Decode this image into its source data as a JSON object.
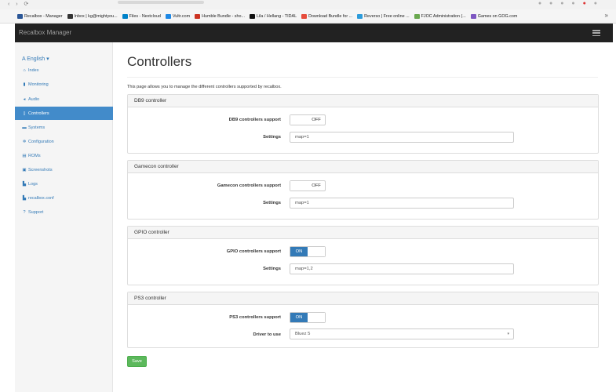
{
  "browser": {
    "bookmarks": [
      {
        "label": "Recalbox - Manager",
        "color": "#2b5797"
      },
      {
        "label": "Inbox | kg@mightyou...",
        "color": "#333333"
      },
      {
        "label": "Files - Nextcloud",
        "color": "#0082c9"
      },
      {
        "label": "Vultr.com",
        "color": "#1e88e5"
      },
      {
        "label": "Humble Bundle - sho...",
        "color": "#cc3322"
      },
      {
        "label": "Lila / Hellang - TIDAL",
        "color": "#111111"
      },
      {
        "label": "Download Bundle for ...",
        "color": "#e74c3c"
      },
      {
        "label": "Reverso | Free online ...",
        "color": "#2d9cdb"
      },
      {
        "label": "FJOC Administration (...",
        "color": "#6aa84f"
      },
      {
        "label": "Games on GOG.com",
        "color": "#7e57c2"
      }
    ],
    "more_label": "»"
  },
  "navbar": {
    "brand": "Recalbox Manager"
  },
  "sidebar": {
    "language": "A English ▾",
    "items": [
      {
        "label": "Index",
        "icon": "home-icon",
        "glyph": "⌂",
        "active": false
      },
      {
        "label": "Monitoring",
        "icon": "bar-chart-icon",
        "glyph": "▮",
        "active": false
      },
      {
        "label": "Audio",
        "icon": "volume-icon",
        "glyph": "◂",
        "active": false
      },
      {
        "label": "Controllers",
        "icon": "gamepad-icon",
        "glyph": "▯",
        "active": true
      },
      {
        "label": "Systems",
        "icon": "monitor-icon",
        "glyph": "▬",
        "active": false
      },
      {
        "label": "Configuration",
        "icon": "cog-icon",
        "glyph": "✲",
        "active": false
      },
      {
        "label": "ROMs",
        "icon": "film-icon",
        "glyph": "▤",
        "active": false
      },
      {
        "label": "Screenshots",
        "icon": "picture-icon",
        "glyph": "▣",
        "active": false
      },
      {
        "label": "Logs",
        "icon": "file-icon",
        "glyph": "▙",
        "active": false
      },
      {
        "label": "recalbox.conf",
        "icon": "file-icon",
        "glyph": "▙",
        "active": false
      },
      {
        "label": "Support",
        "icon": "question-icon",
        "glyph": "?",
        "active": false
      }
    ]
  },
  "main": {
    "title": "Controllers",
    "intro": "This page allows you to manage the different controllers supported by recalbox.",
    "panels": [
      {
        "heading": "DB9 controller",
        "support_label": "DB9 controllers support",
        "toggle": "OFF",
        "settings_label": "Settings",
        "settings_value": "map=1"
      },
      {
        "heading": "Gamecon controller",
        "support_label": "Gamecon controllers support",
        "toggle": "OFF",
        "settings_label": "Settings",
        "settings_value": "map=1"
      },
      {
        "heading": "GPIO controller",
        "support_label": "GPIO controllers support",
        "toggle": "ON",
        "settings_label": "Settings",
        "settings_value": "map=1,2"
      },
      {
        "heading": "PS3 controller",
        "support_label": "PS3 controllers support",
        "toggle": "ON",
        "settings_label": "Driver to use",
        "settings_value": "Bluez 5"
      }
    ],
    "save_label": "Save"
  },
  "colors": {
    "navbar": "#222222",
    "active_nav": "#428bca",
    "toggle_on": "#337ab7",
    "save": "#5cb85c"
  }
}
